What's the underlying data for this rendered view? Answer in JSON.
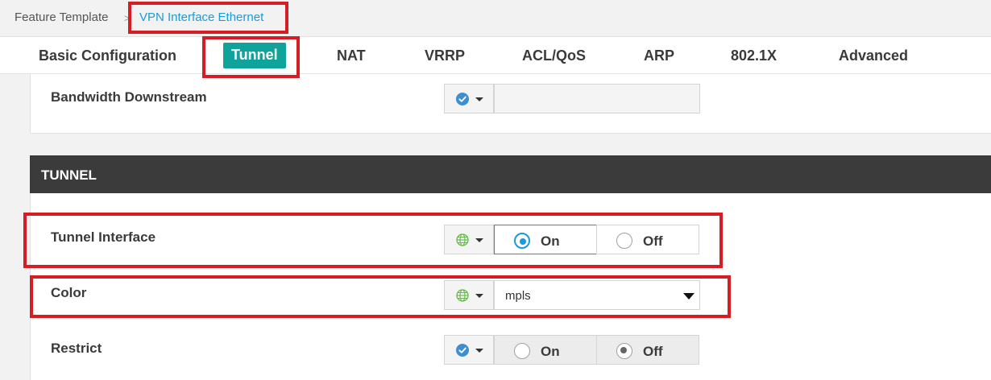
{
  "breadcrumb": {
    "root": "Feature Template",
    "separator": ">",
    "current": "VPN Interface Ethernet"
  },
  "tabs": [
    {
      "label": "Basic Configuration",
      "active": false
    },
    {
      "label": "Tunnel",
      "active": true
    },
    {
      "label": "NAT",
      "active": false
    },
    {
      "label": "VRRP",
      "active": false
    },
    {
      "label": "ACL/QoS",
      "active": false
    },
    {
      "label": "ARP",
      "active": false
    },
    {
      "label": "802.1X",
      "active": false
    },
    {
      "label": "Advanced",
      "active": false
    }
  ],
  "fields": {
    "bandwidth_downstream": {
      "label": "Bandwidth Downstream",
      "scope_icon": "check-circle-icon",
      "value": ""
    },
    "tunnel_interface": {
      "label": "Tunnel Interface",
      "scope_icon": "globe-icon",
      "options": [
        "On",
        "Off"
      ],
      "selected": "On"
    },
    "color": {
      "label": "Color",
      "scope_icon": "globe-icon",
      "value": "mpls"
    },
    "restrict": {
      "label": "Restrict",
      "scope_icon": "check-circle-icon",
      "options": [
        "On",
        "Off"
      ],
      "selected": "Off"
    }
  },
  "section": {
    "title": "TUNNEL"
  },
  "colors": {
    "accent": "#10a39b",
    "link": "#1a9bd7",
    "highlight": "#d81c24",
    "section_header": "#3b3b3b"
  }
}
